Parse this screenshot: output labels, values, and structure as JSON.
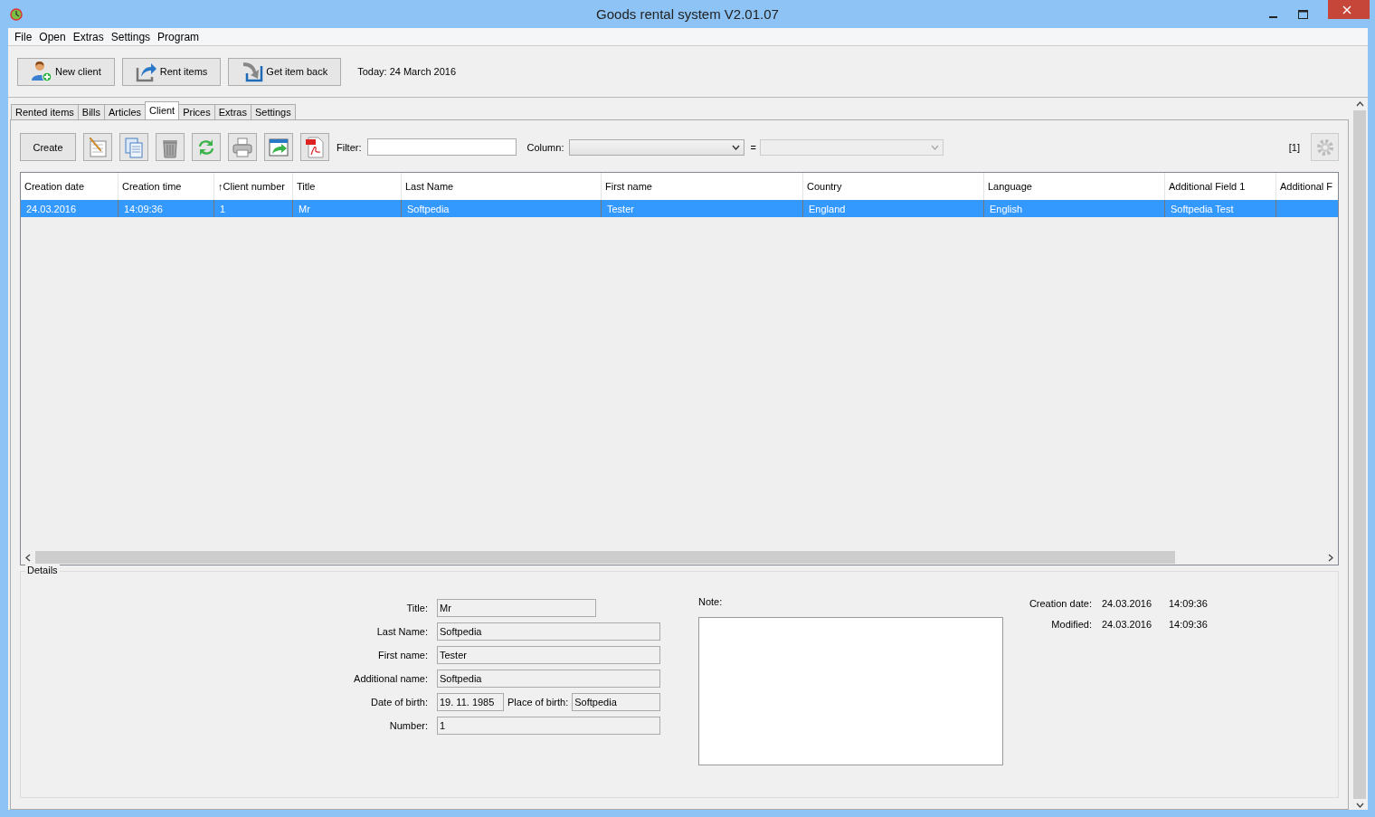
{
  "window": {
    "title": "Goods rental system V2.01.07"
  },
  "menu": [
    "File",
    "Open",
    "Extras",
    "Settings",
    "Program"
  ],
  "toolbar": {
    "buttons": [
      {
        "label": "New client",
        "kind": "user"
      },
      {
        "label": "Rent items",
        "kind": "rent"
      },
      {
        "label": "Get item back",
        "kind": "back"
      }
    ],
    "today": "Today: 24 March 2016"
  },
  "tabs": [
    {
      "label": "Rented items",
      "selected": false
    },
    {
      "label": "Bills",
      "selected": false
    },
    {
      "label": "Articles",
      "selected": false
    },
    {
      "label": "Client",
      "selected": true
    },
    {
      "label": "Prices",
      "selected": false
    },
    {
      "label": "Extras",
      "selected": false
    },
    {
      "label": "Settings",
      "selected": false
    }
  ],
  "client_toolbar": {
    "create": "Create",
    "tools": [
      {
        "kind": "edit"
      },
      {
        "kind": "copy"
      },
      {
        "kind": "delete"
      },
      {
        "kind": "refresh"
      },
      {
        "kind": "print"
      },
      {
        "kind": "export"
      },
      {
        "kind": "pdf"
      }
    ],
    "filter_label": "Filter:",
    "column_label": "Column:",
    "equals": "=",
    "count": "[1]"
  },
  "table": {
    "columns": [
      {
        "label": "Creation date"
      },
      {
        "label": "Creation time"
      },
      {
        "label": "Client number",
        "sort_marker": "↑"
      },
      {
        "label": "Title"
      },
      {
        "label": "Last Name"
      },
      {
        "label": "First name"
      },
      {
        "label": "Country"
      },
      {
        "label": "Language"
      },
      {
        "label": "Additional Field 1"
      },
      {
        "label": "Additional F"
      }
    ],
    "rows": [
      {
        "selected": true,
        "cells": [
          "24.03.2016",
          "14:09:36",
          "1",
          "Mr",
          "Softpedia",
          "Tester",
          "England",
          "English",
          "Softpedia Test",
          ""
        ]
      }
    ]
  },
  "details": {
    "title": "Details",
    "fields": [
      {
        "kind": "short",
        "label": "Title:",
        "value": "Mr"
      },
      {
        "kind": "full",
        "label": "Last Name:",
        "value": "Softpedia"
      },
      {
        "kind": "full",
        "label": "First name:",
        "value": "Tester"
      },
      {
        "kind": "full",
        "label": "Additional name:",
        "value": "Softpedia"
      },
      {
        "kind": "pair",
        "label": "Date of birth:",
        "value": "19. 11. 1985",
        "label2": "Place of birth:",
        "value2": "Softpedia"
      },
      {
        "kind": "full",
        "label": "Number:",
        "value": "1"
      }
    ],
    "note_label": "Note:",
    "stamps": [
      {
        "label": "Creation date:",
        "date": "24.03.2016",
        "time": "14:09:36"
      },
      {
        "label": "Modified:",
        "date": "24.03.2016",
        "time": "14:09:36"
      }
    ]
  }
}
